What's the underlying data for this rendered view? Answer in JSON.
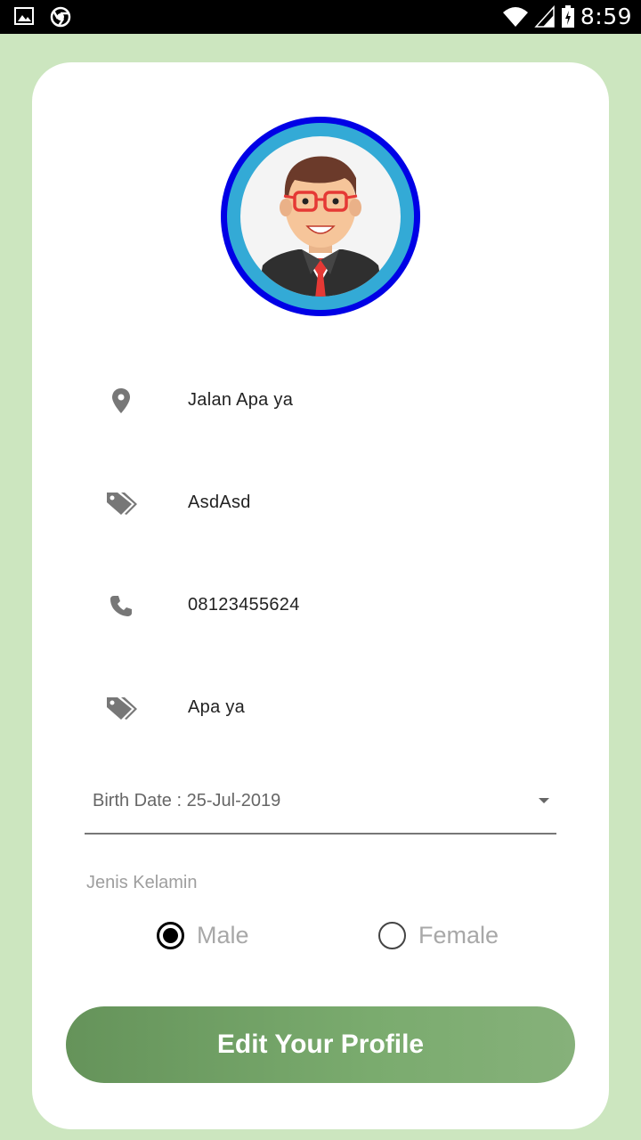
{
  "status_bar": {
    "time": "8:59"
  },
  "profile": {
    "address": "Jalan Apa ya",
    "tag_1": "AsdAsd",
    "phone": "08123455624",
    "tag_2": "Apa ya",
    "birth_date_label": "Birth Date : 25-Jul-2019"
  },
  "gender": {
    "label": "Jenis Kelamin",
    "options": [
      {
        "label": "Male",
        "selected": true
      },
      {
        "label": "Female",
        "selected": false
      }
    ]
  },
  "button": {
    "edit_label": "Edit Your Profile"
  },
  "colors": {
    "background": "#cce6bf",
    "button": "#6f9f63",
    "avatar_ring_outer": "#0000e6",
    "avatar_ring_inner": "#33aad6",
    "icon": "#777777"
  }
}
